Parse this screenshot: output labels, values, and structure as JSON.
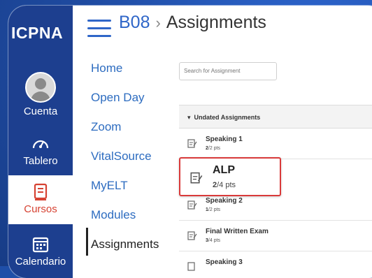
{
  "rail": {
    "logo": "ICPNA",
    "items": [
      {
        "label": "Cuenta",
        "icon": "avatar-icon"
      },
      {
        "label": "Tablero",
        "icon": "dashboard-icon"
      },
      {
        "label": "Cursos",
        "icon": "book-icon",
        "active": true
      },
      {
        "label": "Calendario",
        "icon": "calendar-icon"
      }
    ]
  },
  "header": {
    "course": "B08",
    "separator": "›",
    "page": "Assignments"
  },
  "course_nav": [
    "Home",
    "Open Day",
    "Zoom",
    "VitalSource",
    "MyELT",
    "Modules",
    "Assignments"
  ],
  "search": {
    "placeholder": "Search for Assignment"
  },
  "group": {
    "title": "Undated Assignments"
  },
  "assignments": [
    {
      "title": "Speaking 1",
      "score": "2",
      "total": "/2 pts"
    },
    {
      "title": "ALP",
      "score": "2",
      "total": "/4 pts"
    },
    {
      "title": "Speaking 2",
      "score": "1",
      "total": "/2 pts"
    },
    {
      "title": "Final Written Exam",
      "score": "3",
      "total": "/4 pts"
    },
    {
      "title": "Speaking 3"
    }
  ],
  "colors": {
    "rail": "#1d3f8f",
    "link": "#2d6cc0",
    "highlight": "#d93a3a",
    "active_nav": "#d64232"
  }
}
